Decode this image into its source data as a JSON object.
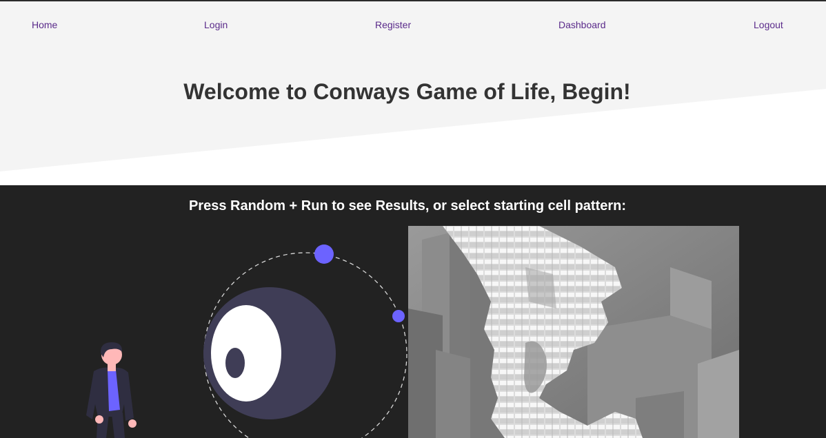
{
  "nav": {
    "items": [
      {
        "label": "Home"
      },
      {
        "label": "Login"
      },
      {
        "label": "Register"
      },
      {
        "label": "Dashboard"
      },
      {
        "label": "Logout"
      }
    ]
  },
  "hero": {
    "title": "Welcome to Conways Game of Life, Begin!"
  },
  "section": {
    "title": "Press Random + Run to see Results, or select starting cell pattern:"
  },
  "colors": {
    "nav_link": "#5a2a8a",
    "hero_bg": "#f4f4f4",
    "dark_bg": "#222222",
    "accent": "#6c63ff",
    "planet": "#3f3d56"
  },
  "icons": {
    "illustration": "person-with-orbit-illustration",
    "image": "3d-voxel-cells-render"
  }
}
